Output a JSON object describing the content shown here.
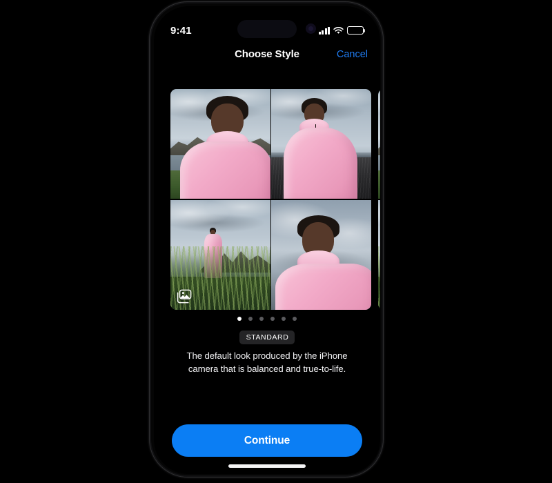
{
  "device": {
    "status_bar": {
      "time": "9:41",
      "cellular_icon": "signal-bars-icon",
      "wifi_icon": "wifi-icon",
      "battery_icon": "battery-icon"
    },
    "home_indicator": "home-indicator"
  },
  "nav": {
    "title": "Choose Style",
    "cancel_label": "Cancel"
  },
  "carousel": {
    "badge_icon": "photo-stack-icon",
    "cards": [
      {
        "id": "standard",
        "photos": [
          "portrait-selfie-mountains",
          "full-body-black-sand-beach",
          "distant-figure-tall-grass",
          "close-up-portrait-sky"
        ]
      },
      {
        "id": "next-style-preview",
        "photos": [
          "portrait-selfie-mountains",
          "full-body-black-sand-beach",
          "distant-figure-tall-grass",
          "close-up-portrait-sky"
        ]
      }
    ],
    "dots": {
      "count": 6,
      "active_index": 0
    }
  },
  "style": {
    "badge_label": "STANDARD",
    "description": "The default look produced by the iPhone camera that is balanced and true-to-life."
  },
  "footer": {
    "continue_label": "Continue"
  },
  "colors": {
    "accent_blue": "#0b7ef4",
    "cancel_blue": "#1f7bf0",
    "screen_background": "#000000",
    "badge_background": "#242426",
    "dot_active": "#ffffff",
    "dot_inactive": "#5b5b5e",
    "coat_pink": "#f2aac8"
  }
}
